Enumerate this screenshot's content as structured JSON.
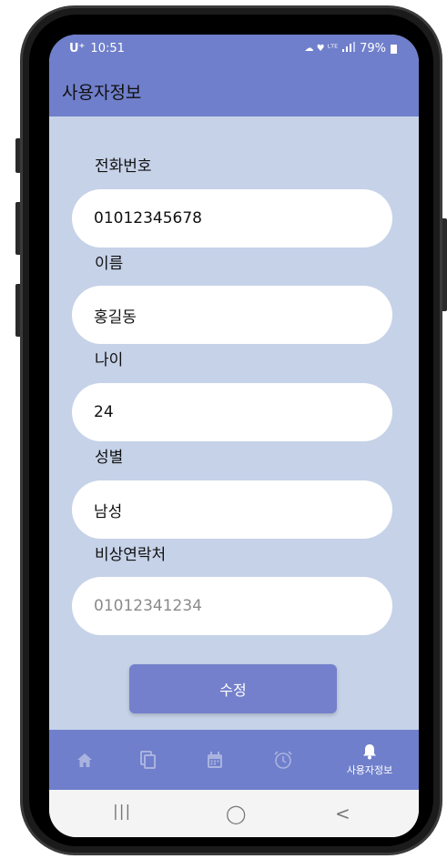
{
  "status_bar": {
    "carrier": "U⁺",
    "time": "10:51",
    "indicators": "☁ ♥ ᴸᵀᴱ",
    "battery": "79%"
  },
  "app_bar": {
    "title": "사용자정보"
  },
  "form": {
    "fields": [
      {
        "label": "전화번호",
        "value": "01012345678",
        "placeholder": ""
      },
      {
        "label": "이름",
        "value": "홍길동",
        "placeholder": ""
      },
      {
        "label": "나이",
        "value": "24",
        "placeholder": ""
      },
      {
        "label": "성별",
        "value": "남성",
        "placeholder": ""
      },
      {
        "label": "비상연락처",
        "value": "",
        "placeholder": "01012341234"
      }
    ],
    "submit_label": "수정"
  },
  "bottom_nav": {
    "items": [
      {
        "icon": "home-icon",
        "label": ""
      },
      {
        "icon": "copy-icon",
        "label": ""
      },
      {
        "icon": "calendar-icon",
        "label": ""
      },
      {
        "icon": "alarm-icon",
        "label": ""
      },
      {
        "icon": "bell-icon",
        "label": "사용자정보"
      }
    ],
    "active_index": 4
  },
  "system_nav": {
    "recents": "|||",
    "home": "◯",
    "back": "<"
  },
  "colors": {
    "accent": "#6f7fcb",
    "screen_bg": "#c6d2e8",
    "button": "#7580cc"
  }
}
